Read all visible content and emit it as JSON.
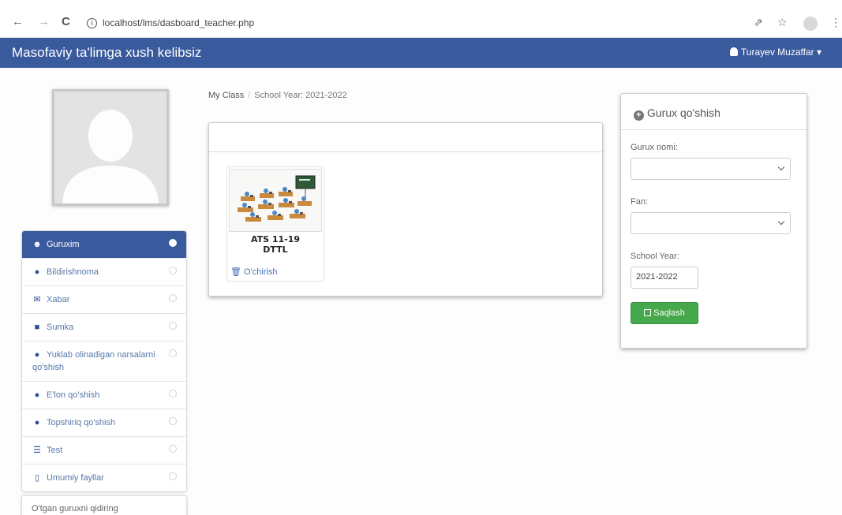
{
  "browser": {
    "url": "localhost/lms/dasboard_teacher.php",
    "back_glyph": "←",
    "forward_glyph": "→",
    "reload_glyph": "C",
    "info_glyph": "i",
    "share_glyph": "⇗",
    "star_glyph": "☆",
    "menu_glyph": "⋮"
  },
  "navbar": {
    "title": "Masofaviy ta'limga xush kelibsiz",
    "user_name": "Turayev Muzaffar",
    "user_caret": "▾",
    "color": "#3a5a9e"
  },
  "breadcrumb": {
    "first": "My Class",
    "separator": "/",
    "second": "School Year: 2021-2022"
  },
  "sidebar": {
    "items": [
      {
        "icon": "users-icon",
        "glyph": "☻",
        "label": "Guruxim",
        "active": true
      },
      {
        "icon": "info-circle-icon",
        "glyph": "●",
        "label": "Bildirishnoma",
        "active": false
      },
      {
        "icon": "envelope-icon",
        "glyph": "✉",
        "label": "Xabar",
        "active": false
      },
      {
        "icon": "briefcase-icon",
        "glyph": "■",
        "label": "Sumka",
        "active": false
      },
      {
        "icon": "plus-circle-icon",
        "glyph": "●",
        "label": "Yuklab olinadigan narsalarni qo'shish",
        "active": false
      },
      {
        "icon": "plus-circle-icon",
        "glyph": "●",
        "label": "E'lon qo'shish",
        "active": false
      },
      {
        "icon": "plus-circle-icon",
        "glyph": "●",
        "label": "Topshiriq qo'shish",
        "active": false
      },
      {
        "icon": "list-icon",
        "glyph": "☰",
        "label": "Test",
        "active": false
      },
      {
        "icon": "file-icon",
        "glyph": "▯",
        "label": "Umumiy fayllar",
        "active": false
      }
    ],
    "search_label": "O'tgan guruxni qidiring"
  },
  "class_card": {
    "name_line1": "ATS 11-19",
    "name_line2": "DTTL",
    "delete_glyph": "🗑",
    "delete_label": "O'chirish"
  },
  "add_group": {
    "header_glyph": "+",
    "title": "Gurux qo'shish",
    "group_name_label": "Gurux nomi:",
    "subject_label": "Fan:",
    "school_year_label": "School Year:",
    "school_year_value": "2021-2022",
    "save_label": "Saqlash",
    "save_color": "#45a84a"
  }
}
